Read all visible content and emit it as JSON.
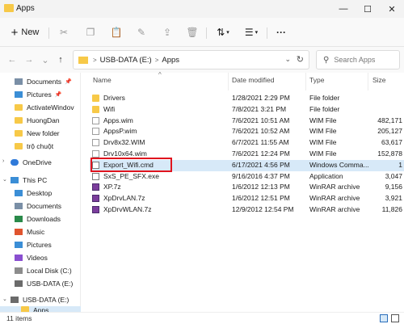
{
  "window": {
    "title": "Apps",
    "minimize_glyph": "—",
    "maximize_glyph": "☐",
    "close_glyph": "✕"
  },
  "toolbar": {
    "new_label": "New",
    "new_glyph": "+",
    "cut_glyph": "✂",
    "copy_glyph": "❐",
    "paste_glyph": "📋",
    "rename_glyph": "✎",
    "share_glyph": "⇪",
    "delete_glyph": "🗑",
    "sort_glyph": "⇅",
    "sort_chevron": "▾",
    "view_glyph": "☰",
    "view_chevron": "▾",
    "more_glyph": "···"
  },
  "nav_buttons": {
    "back": "←",
    "forward": "→",
    "recent": "⌄",
    "up": "↑"
  },
  "address": {
    "breadcrumbs": [
      "USB-DATA (E:)",
      "Apps"
    ],
    "separator": ">",
    "dropdown_glyph": "⌄",
    "refresh_glyph": "↻"
  },
  "search": {
    "placeholder": "Search Apps",
    "glyph": "⚲"
  },
  "sidebar": {
    "quick_access": [
      {
        "label": "Documents",
        "pinned": true
      },
      {
        "label": "Pictures",
        "pinned": true
      },
      {
        "label": "ActivateWindov",
        "pinned": false
      },
      {
        "label": "HuongDan",
        "pinned": false
      },
      {
        "label": "New folder",
        "pinned": false
      },
      {
        "label": "trộ chuột",
        "pinned": false
      }
    ],
    "onedrive": "OneDrive",
    "this_pc": "This PC",
    "this_pc_items": [
      "Desktop",
      "Documents",
      "Downloads",
      "Music",
      "Pictures",
      "Videos",
      "Local Disk (C:)",
      "USB-DATA (E:)"
    ],
    "drive_expanded": "USB-DATA (E:)",
    "drive_child": "Apps",
    "pin_glyph": "📌",
    "chevron_expand": "›",
    "chevron_collapse": "⌄"
  },
  "columns": {
    "name": "Name",
    "date": "Date modified",
    "type": "Type",
    "size": "Size",
    "sort_glyph": "^"
  },
  "files": [
    {
      "name": "Drivers",
      "date": "1/28/2021 2:29 PM",
      "type": "File folder",
      "size": "",
      "icon": "folder"
    },
    {
      "name": "Wifi",
      "date": "7/8/2021 3:21 PM",
      "type": "File folder",
      "size": "",
      "icon": "folder"
    },
    {
      "name": "Apps.wim",
      "date": "7/6/2021 10:51 AM",
      "type": "WIM File",
      "size": "482,171 K",
      "icon": "file"
    },
    {
      "name": "AppsP.wim",
      "date": "7/6/2021 10:52 AM",
      "type": "WIM File",
      "size": "205,127 K",
      "icon": "file"
    },
    {
      "name": "Drv8x32.WIM",
      "date": "6/7/2021 11:55 AM",
      "type": "WIM File",
      "size": "63,617 K",
      "icon": "file"
    },
    {
      "name": "Drv10x64.wim",
      "date": "7/6/2021 12:24 PM",
      "type": "WIM File",
      "size": "152,878 K",
      "icon": "file"
    },
    {
      "name": "Export_Wifi.cmd",
      "date": "6/17/2021 4:56 PM",
      "type": "Windows Comma...",
      "size": "1 K",
      "icon": "cmd"
    },
    {
      "name": "SxS_PE_SFX.exe",
      "date": "9/16/2016 4:37 PM",
      "type": "Application",
      "size": "3,047 K",
      "icon": "app"
    },
    {
      "name": "XP.7z",
      "date": "1/6/2012 12:13 PM",
      "type": "WinRAR archive",
      "size": "9,156 K",
      "icon": "rar"
    },
    {
      "name": "XpDrvLAN.7z",
      "date": "1/6/2012 12:51 PM",
      "type": "WinRAR archive",
      "size": "3,921 K",
      "icon": "rar"
    },
    {
      "name": "XpDrvWLAN.7z",
      "date": "12/9/2012 12:54 PM",
      "type": "WinRAR archive",
      "size": "11,826 K",
      "icon": "rar"
    }
  ],
  "status": {
    "item_count": "11 items"
  },
  "colors": {
    "accent": "#2a6ebb",
    "selection": "#d7e9f8",
    "highlight_box": "#e0141e",
    "folder": "#f7c948"
  }
}
